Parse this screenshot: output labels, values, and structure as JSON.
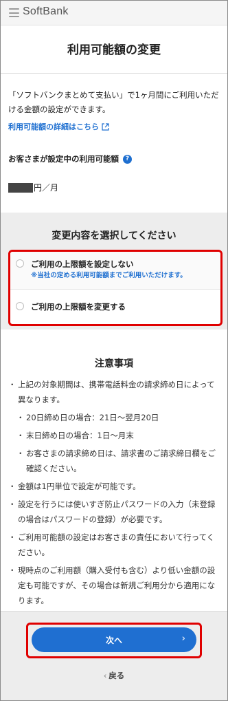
{
  "header": {
    "brand": "SoftBank"
  },
  "page": {
    "title": "利用可能額の変更"
  },
  "intro": {
    "text": "「ソフトバンクまとめて支払い」で1ヶ月間にご利用いただける金額の設定ができます。",
    "detail_link": "利用可能額の詳細はこちら"
  },
  "current": {
    "label": "お客さまが設定中の利用可能額",
    "unit": "円／月"
  },
  "selection": {
    "title": "変更内容を選択してください",
    "options": [
      {
        "label": "ご利用の上限額を設定しない",
        "note": "※当社の定める利用可能額までご利用いただけます。"
      },
      {
        "label": "ご利用の上限額を変更する"
      }
    ]
  },
  "notes": {
    "title": "注意事項",
    "items": [
      "上記の対象期間は、携帯電話料金の請求締め日によって異なります。",
      "20日締め日の場合：21日～翌月20日",
      "末日締め日の場合：1日～月末",
      "お客さまの請求締め日は、請求書のご請求締日欄をご確認ください。",
      "金額は1円単位で設定が可能です。",
      "設定を行うには使いすぎ防止パスワードの入力（未登録の場合はパスワードの登録）が必要です。",
      "ご利用可能額の設定はお客さまの責任において行ってください。",
      "現時点のご利用額（購入受付も含む）より低い金額の設定も可能ですが、その場合は新規ご利用分から適用になります。"
    ]
  },
  "footer": {
    "next_label": "次へ",
    "back_label": "戻る"
  },
  "colors": {
    "accent": "#1f6fd1",
    "highlight": "#e00000"
  }
}
